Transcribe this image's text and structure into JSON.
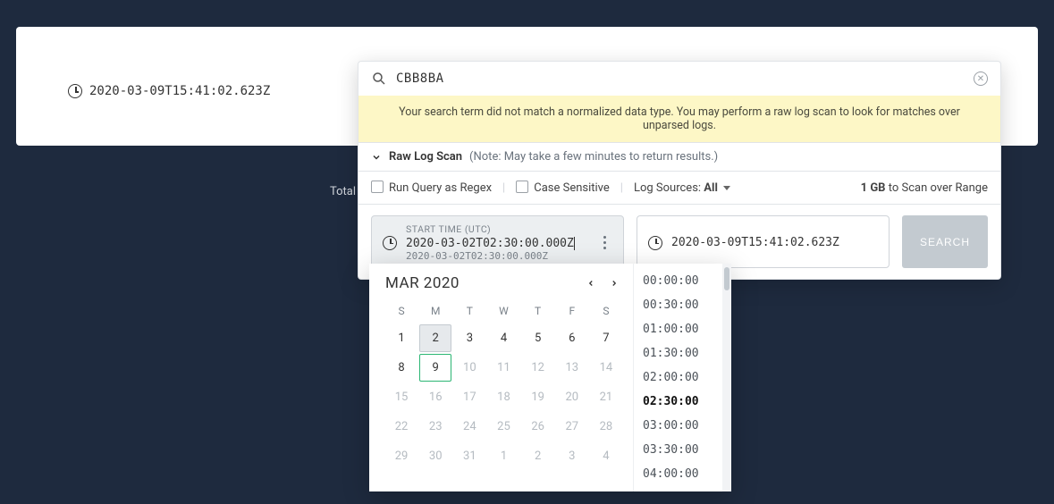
{
  "page": {
    "timestamp": "2020-03-09T15:41:02.623Z",
    "total_label": "Total L"
  },
  "panel": {
    "search_value": "CBB8BA",
    "warning": "Your search term did not match a normalized data type. You may perform a raw log scan to look for matches over unparsed logs.",
    "rawlog_label": "Raw Log Scan",
    "rawlog_note": "(Note: May take a few minutes to return results.)",
    "opt_regex": "Run Query as Regex",
    "opt_case": "Case Sensitive",
    "log_sources_label": "Log Sources:",
    "log_sources_value": "All",
    "scan_amount": "1 GB",
    "scan_suffix": "to Scan over Range",
    "start_title": "START TIME (UTC)",
    "start_value": "2020-03-02T02:30:00.000Z",
    "start_sub": "2020-03-02T02:30:00.000Z",
    "end_value": "2020-03-09T15:41:02.623Z",
    "search_btn": "SEARCH"
  },
  "calendar": {
    "title": "MAR 2020",
    "dow": [
      "S",
      "M",
      "T",
      "W",
      "T",
      "F",
      "S"
    ],
    "weeks": [
      [
        {
          "n": "1"
        },
        {
          "n": "2",
          "sel": true
        },
        {
          "n": "3"
        },
        {
          "n": "4"
        },
        {
          "n": "5"
        },
        {
          "n": "6"
        },
        {
          "n": "7"
        }
      ],
      [
        {
          "n": "8"
        },
        {
          "n": "9",
          "today": true
        },
        {
          "n": "10",
          "dim": true
        },
        {
          "n": "11",
          "dim": true
        },
        {
          "n": "12",
          "dim": true
        },
        {
          "n": "13",
          "dim": true
        },
        {
          "n": "14",
          "dim": true
        }
      ],
      [
        {
          "n": "15",
          "dim": true
        },
        {
          "n": "16",
          "dim": true
        },
        {
          "n": "17",
          "dim": true
        },
        {
          "n": "18",
          "dim": true
        },
        {
          "n": "19",
          "dim": true
        },
        {
          "n": "20",
          "dim": true
        },
        {
          "n": "21",
          "dim": true
        }
      ],
      [
        {
          "n": "22",
          "dim": true
        },
        {
          "n": "23",
          "dim": true
        },
        {
          "n": "24",
          "dim": true
        },
        {
          "n": "25",
          "dim": true
        },
        {
          "n": "26",
          "dim": true
        },
        {
          "n": "27",
          "dim": true
        },
        {
          "n": "28",
          "dim": true
        }
      ],
      [
        {
          "n": "29",
          "dim": true
        },
        {
          "n": "30",
          "dim": true
        },
        {
          "n": "31",
          "dim": true
        },
        {
          "n": "1",
          "dim": true
        },
        {
          "n": "2",
          "dim": true
        },
        {
          "n": "3",
          "dim": true
        },
        {
          "n": "4",
          "dim": true
        }
      ]
    ],
    "times": [
      {
        "t": "00:00:00"
      },
      {
        "t": "00:30:00"
      },
      {
        "t": "01:00:00"
      },
      {
        "t": "01:30:00"
      },
      {
        "t": "02:00:00"
      },
      {
        "t": "02:30:00",
        "sel": true
      },
      {
        "t": "03:00:00"
      },
      {
        "t": "03:30:00"
      },
      {
        "t": "04:00:00"
      }
    ]
  }
}
